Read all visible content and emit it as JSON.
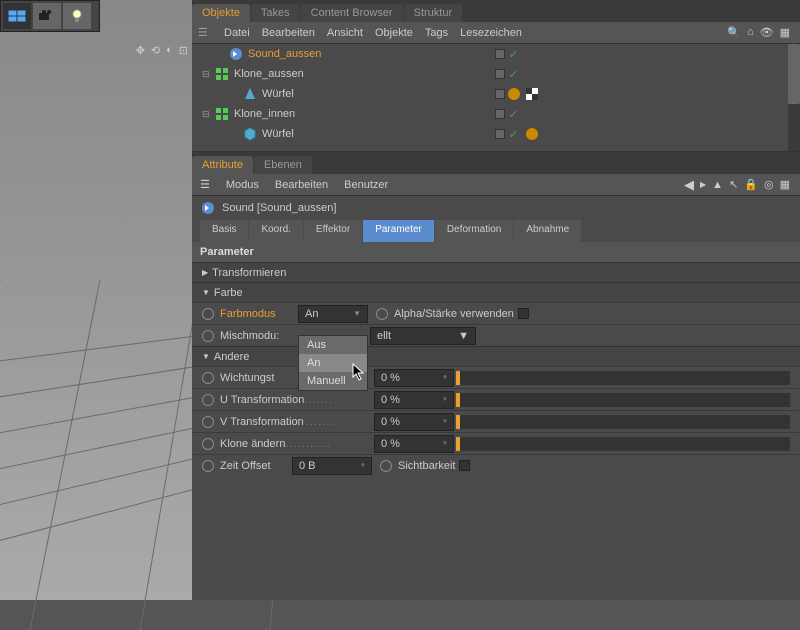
{
  "objects_panel": {
    "tabs": [
      "Objekte",
      "Takes",
      "Content Browser",
      "Struktur"
    ],
    "active_tab": 0,
    "menu": [
      "Datei",
      "Bearbeiten",
      "Ansicht",
      "Objekte",
      "Tags",
      "Lesezeichen"
    ],
    "hierarchy": [
      {
        "name": "Sound_aussen",
        "selected": true,
        "indent": 0,
        "has_exp": false,
        "icon": "sound"
      },
      {
        "name": "Klone_aussen",
        "indent": 0,
        "has_exp": true,
        "icon": "cloner"
      },
      {
        "name": "Würfel",
        "indent": 1,
        "icon": "cube",
        "tags": true
      },
      {
        "name": "Klone_innen",
        "indent": 0,
        "has_exp": true,
        "icon": "cloner"
      },
      {
        "name": "Würfel",
        "indent": 1,
        "icon": "cube2",
        "tags2": true
      }
    ]
  },
  "attributes": {
    "tabs": [
      "Attribute",
      "Ebenen"
    ],
    "active_tab": 0,
    "menu": [
      "Modus",
      "Bearbeiten",
      "Benutzer"
    ],
    "object_label": "Sound [Sound_aussen]",
    "param_tabs": [
      "Basis",
      "Koord.",
      "Effektor",
      "Parameter",
      "Deformation",
      "Abnahme"
    ],
    "active_param_tab": 3,
    "section_title": "Parameter",
    "groups": {
      "transformieren": "Transformieren",
      "farbe": "Farbe",
      "andere": "Andere"
    },
    "farbe": {
      "farbmodus_label": "Farbmodus",
      "farbmodus_value": "An",
      "alpha_label": "Alpha/Stärke verwenden",
      "mischmodus_label": "Mischmodu:",
      "mischmodus_partial": "ellt"
    },
    "dropdown_options": [
      "Aus",
      "An",
      "Manuell"
    ],
    "andere": {
      "wichtung_label": "Wichtungst",
      "utrans_label": "U Transformation",
      "vtrans_label": "V Transformation",
      "klone_label": "Klone ändern",
      "zeit_label": "Zeit Offset",
      "zeit_value": "0 B",
      "sichtbar_label": "Sichtbarkeit",
      "percent": "0 %"
    }
  }
}
